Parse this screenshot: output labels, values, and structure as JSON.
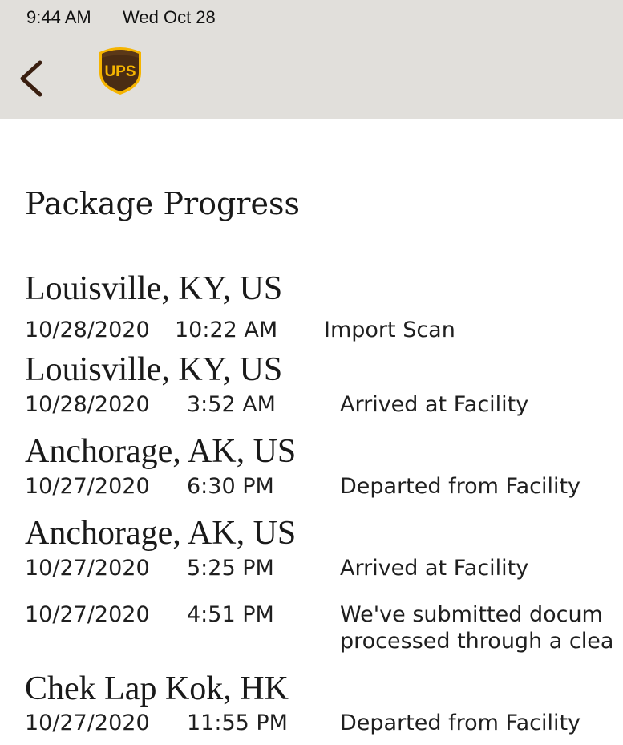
{
  "status_bar": {
    "time": "9:44 AM",
    "date": "Wed Oct 28"
  },
  "header": {
    "back_icon": "chevron-left-icon",
    "logo": "UPS",
    "colors": {
      "bar_background": "#e1dfdb",
      "logo_brown": "#4a2c13",
      "logo_gold": "#f5b400",
      "back_icon": "#3a1f10"
    }
  },
  "main": {
    "title": "Package Progress",
    "locations": [
      "Louisville, KY, US",
      "Louisville, KY, US",
      "Anchorage, AK, US",
      "Anchorage, AK, US",
      "Chek Lap Kok, HK"
    ],
    "events": [
      {
        "date": "10/28/2020",
        "time": "10:22 AM",
        "description": "Import Scan"
      },
      {
        "date": "10/28/2020",
        "time": "3:52 AM",
        "description": "Arrived at Facility"
      },
      {
        "date": "10/27/2020",
        "time": "6:30 PM",
        "description": "Departed from Facility"
      },
      {
        "date": "10/27/2020",
        "time": "5:25 PM",
        "description": "Arrived at Facility"
      },
      {
        "date": "10/27/2020",
        "time": "4:51 PM",
        "description_lines": [
          "We've submitted docum",
          "processed through a clea"
        ]
      },
      {
        "date": "10/27/2020",
        "time": "11:55 PM",
        "description": "Departed from Facility"
      }
    ]
  }
}
